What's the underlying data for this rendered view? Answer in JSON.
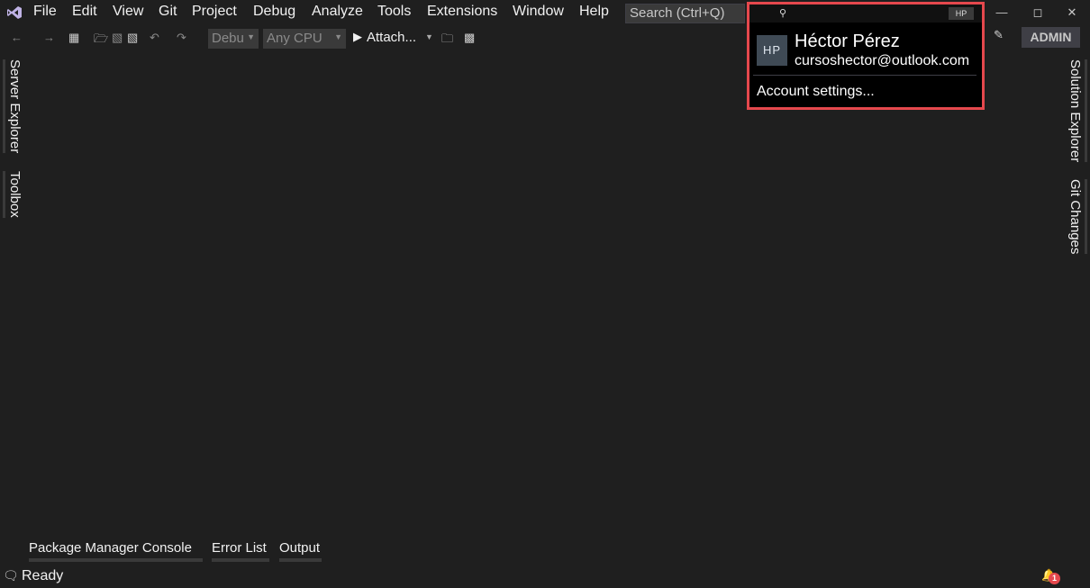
{
  "menu": [
    "File",
    "Edit",
    "View",
    "Git",
    "Project",
    "Debug",
    "Analyze",
    "Tools",
    "Extensions",
    "Window",
    "Help"
  ],
  "search": {
    "placeholder": "Search (Ctrl+Q)"
  },
  "toolbar": {
    "config": "Debu",
    "platform": "Any CPU",
    "attach": "Attach..."
  },
  "user_badge": "ADMIN",
  "side_tabs_left": [
    "Server Explorer",
    "Toolbox"
  ],
  "side_tabs_right": [
    "Solution Explorer",
    "Git Changes"
  ],
  "bottom_tabs": [
    "Package Manager Console",
    "Error List",
    "Output"
  ],
  "status": {
    "text": "Ready",
    "notification_count": "1"
  },
  "account": {
    "initials": "HP",
    "name": "Héctor Pérez",
    "email": "cursoshector@outlook.com",
    "settings_label": "Account settings..."
  },
  "colors": {
    "highlight_border": "#e5484d",
    "background": "#1f1f1f"
  },
  "icons": [
    "visual-studio-logo-icon",
    "search-icon",
    "minimize-icon",
    "maximize-icon",
    "close-icon",
    "feedback-icon",
    "notification-bell-icon"
  ]
}
